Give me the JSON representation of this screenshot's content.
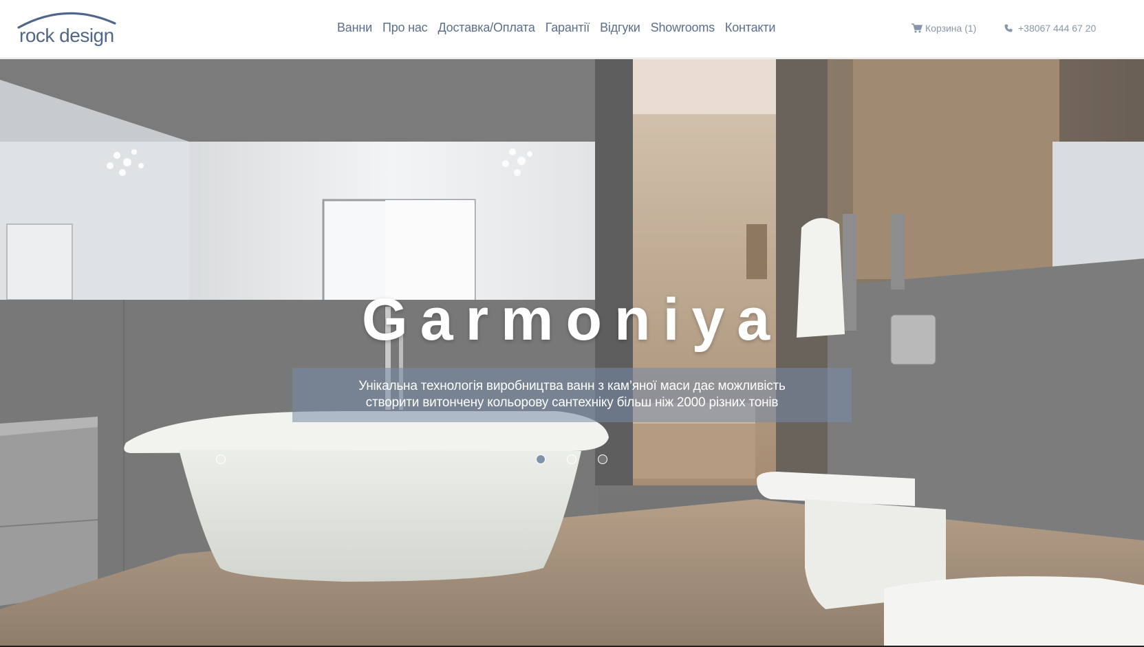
{
  "header": {
    "logo_text": "rock design",
    "nav": [
      "Ванни",
      "Про нас",
      "Доставка/Оплата",
      "Гарантії",
      "Відгуки",
      "Showrooms",
      "Контакти"
    ],
    "cart_label": "Корзина (1)",
    "phone_label": "+38067 444 67 20"
  },
  "hero": {
    "title": "Garmoniya",
    "description_line1": "Унікальна технологія виробництва ванн з кам’яної маси дає можливість",
    "description_line2": "створити витончену кольорову сантехніку більш ніж 2000 різних тонів",
    "slides": {
      "count": 4,
      "active_index": 1
    }
  },
  "icons": {
    "cart": "shopping-cart-icon",
    "phone": "phone-icon"
  },
  "colors": {
    "brand": "#50678a",
    "nav_text": "#5b6f8c",
    "header_meta": "#8896aa",
    "hero_box": "#768aa8"
  }
}
